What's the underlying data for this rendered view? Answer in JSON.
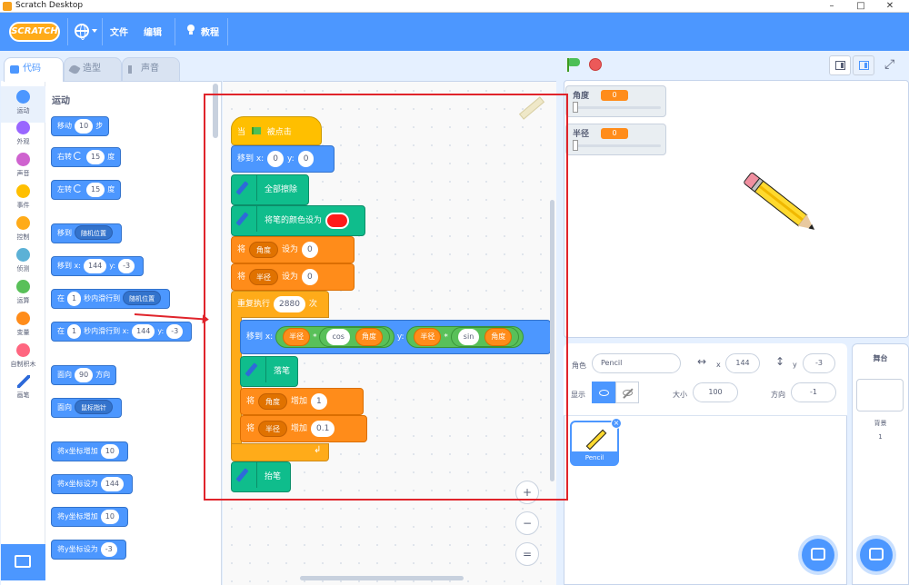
{
  "window": {
    "title": "Scratch Desktop"
  },
  "menu": {
    "logo": "SCRATCH",
    "file": "文件",
    "edit": "编辑",
    "tutorials": "教程"
  },
  "tabs": {
    "code": "代码",
    "costumes": "造型",
    "sounds": "声音"
  },
  "categories": [
    {
      "label": "运动",
      "color": "#4c97ff"
    },
    {
      "label": "外观",
      "color": "#9966ff"
    },
    {
      "label": "声音",
      "color": "#cf63cf"
    },
    {
      "label": "事件",
      "color": "#ffbf00"
    },
    {
      "label": "控制",
      "color": "#ffab19"
    },
    {
      "label": "侦测",
      "color": "#5cb1d6"
    },
    {
      "label": "运算",
      "color": "#59c059"
    },
    {
      "label": "变量",
      "color": "#ff8c1a"
    },
    {
      "label": "自制积木",
      "color": "#ff6680"
    },
    {
      "label": "画笔",
      "color": "#0fbd8c"
    }
  ],
  "palette": {
    "title": "运动",
    "move": {
      "a": "移动",
      "v": "10",
      "b": "步"
    },
    "turn_right": {
      "a": "右转",
      "v": "15",
      "b": "度"
    },
    "turn_left": {
      "a": "左转",
      "v": "15",
      "b": "度"
    },
    "goto": {
      "a": "移到",
      "d": "随机位置"
    },
    "goto_xy": {
      "a": "移到 x:",
      "x": "144",
      "y_label": "y:",
      "y": "-3"
    },
    "glide": {
      "a": "在",
      "v": "1",
      "b": "秒内滑行到",
      "d": "随机位置"
    },
    "glide_xy": {
      "a": "在",
      "v": "1",
      "b": "秒内滑行到 x:",
      "x": "144",
      "y_label": "y:",
      "y": "-3"
    },
    "point_dir": {
      "a": "面向",
      "v": "90",
      "b": "方向"
    },
    "point_towards": {
      "a": "面向",
      "d": "鼠标指针"
    },
    "change_x": {
      "a": "将x坐标增加",
      "v": "10"
    },
    "set_x": {
      "a": "将x坐标设为",
      "v": "144"
    },
    "change_y": {
      "a": "将y坐标增加",
      "v": "10"
    },
    "set_y": {
      "a": "将y坐标设为",
      "v": "-3"
    }
  },
  "script": {
    "hat": {
      "a": "当",
      "b": "被点击"
    },
    "goto": {
      "a": "移到 x:",
      "x": "0",
      "y_label": "y:",
      "y": "0"
    },
    "clear": "全部擦除",
    "set_color": "将笔的颜色设为",
    "set_angle": {
      "a": "将",
      "var": "角度",
      "b": "设为",
      "v": "0"
    },
    "set_radius": {
      "a": "将",
      "var": "半径",
      "b": "设为",
      "v": "0"
    },
    "repeat": {
      "a": "重复执行",
      "v": "2880",
      "b": "次"
    },
    "inner_goto": {
      "a": "移到 x:",
      "r1": "半径",
      "mul1": "*",
      "f1": "cos",
      "ang1": "角度",
      "y_label": "y:",
      "r2": "半径",
      "mul2": "*",
      "f2": "sin",
      "ang2": "角度"
    },
    "pen_down": "落笔",
    "change_angle": {
      "a": "将",
      "var": "角度",
      "b": "增加",
      "v": "1"
    },
    "change_radius": {
      "a": "将",
      "var": "半径",
      "b": "增加",
      "v": "0.1"
    },
    "pen_up": "抬笔"
  },
  "zoom": {
    "in": "+",
    "out": "−",
    "reset": "="
  },
  "monitors": [
    {
      "label": "角度",
      "value": "0"
    },
    {
      "label": "半径",
      "value": "0"
    }
  ],
  "sprite_info": {
    "sprite_label": "角色",
    "sprite_name": "Pencil",
    "x_label": "x",
    "x": "144",
    "y_label": "y",
    "y": "-3",
    "show_label": "显示",
    "size_label": "大小",
    "size": "100",
    "direction_label": "方向",
    "direction": "-1"
  },
  "sprites": [
    {
      "name": "Pencil"
    }
  ],
  "stage_pane": {
    "title": "舞台",
    "backdrops_label": "背景",
    "backdrops_count": "1"
  },
  "colors": {
    "accent": "#4c97ff",
    "pen_color": "#ff1a1a",
    "highlight": "#e0242b"
  }
}
